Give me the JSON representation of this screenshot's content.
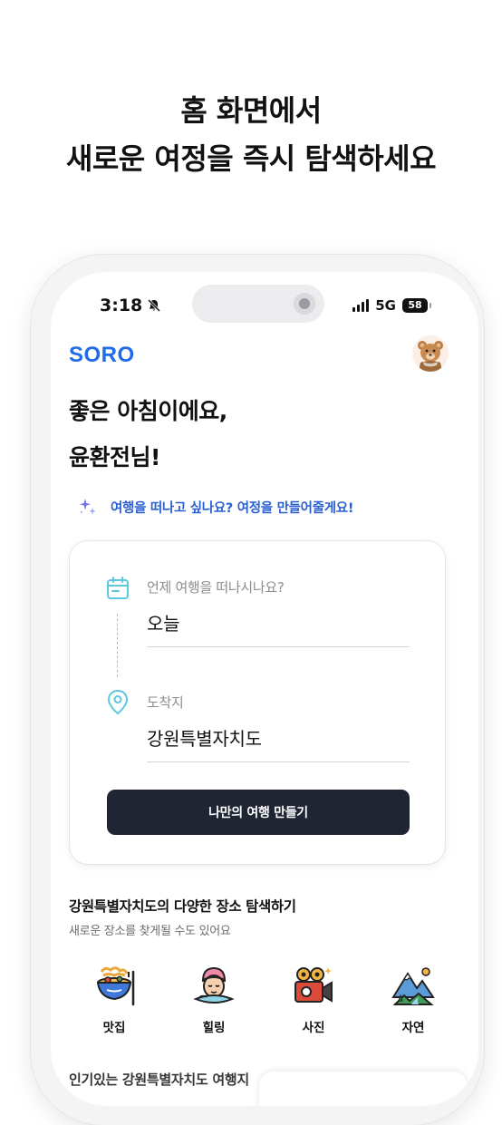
{
  "headline": {
    "line1": "홈 화면에서",
    "line2": "새로운 여정을 즉시 탐색하세요"
  },
  "status_bar": {
    "time": "3:18",
    "network": "5G",
    "battery": "58"
  },
  "app": {
    "logo": "SORO",
    "greeting_line1": "좋은 아침이에요,",
    "greeting_line2": "윤환전님!",
    "prompt": "여행을 떠나고 싶나요? 여정을 만들어줄게요!"
  },
  "trip_form": {
    "date_label": "언제 여행을 떠나시나요?",
    "date_value": "오늘",
    "destination_label": "도착지",
    "destination_value": "강원특별자치도",
    "create_button": "나만의 여행 만들기"
  },
  "explore": {
    "title": "강원특별자치도의 다양한 장소 탐색하기",
    "subtitle": "새로운 장소를 찾게될 수도 있어요",
    "categories": [
      {
        "label": "맛집",
        "icon": "food-bowl-icon"
      },
      {
        "label": "힐링",
        "icon": "spa-face-icon"
      },
      {
        "label": "사진",
        "icon": "camera-icon"
      },
      {
        "label": "자연",
        "icon": "mountain-icon"
      }
    ]
  },
  "next_section_peek": "인기있는 강원특별자치도 여행지",
  "colors": {
    "brand": "#1f6bea",
    "cta_background": "#1f2532",
    "prompt_text": "#2a5fd1",
    "field_icon": "#5bc8e0"
  }
}
